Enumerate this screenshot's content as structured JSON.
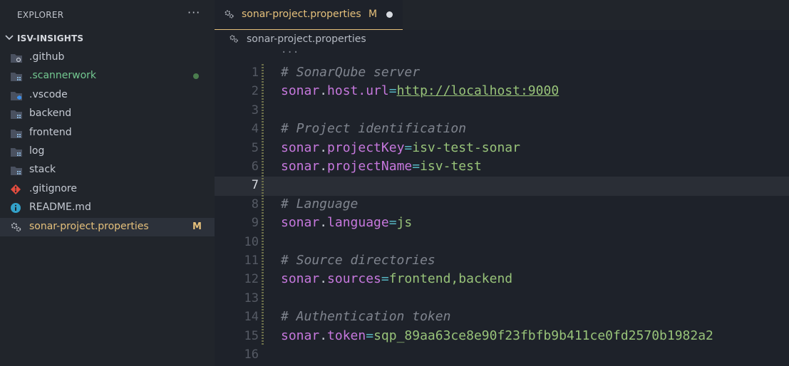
{
  "sidebar": {
    "title": "EXPLORER",
    "more": "···",
    "section": "ISV-INSIGHTS",
    "items": [
      {
        "label": ".github",
        "badge": ""
      },
      {
        "label": ".scannerwork",
        "badge": ""
      },
      {
        "label": ".vscode",
        "badge": ""
      },
      {
        "label": "backend",
        "badge": ""
      },
      {
        "label": "frontend",
        "badge": ""
      },
      {
        "label": "log",
        "badge": ""
      },
      {
        "label": "stack",
        "badge": ""
      },
      {
        "label": ".gitignore",
        "badge": ""
      },
      {
        "label": "README.md",
        "badge": ""
      },
      {
        "label": "sonar-project.properties",
        "badge": "M"
      }
    ]
  },
  "tab": {
    "label": "sonar-project.properties",
    "status": "M"
  },
  "breadcrumb": {
    "label": "sonar-project.properties",
    "sticky": "···"
  },
  "editor": {
    "current_line": 7,
    "lines": [
      {
        "n": "1",
        "comment": "# SonarQube server"
      },
      {
        "n": "2",
        "key": "sonar",
        "prop": "host.url",
        "eq": "=",
        "value": "http://localhost:9000"
      },
      {
        "n": "3"
      },
      {
        "n": "4",
        "comment": "# Project identification"
      },
      {
        "n": "5",
        "key": "sonar",
        "prop": "projectKey",
        "eq": "=",
        "value": "isv-test-sonar"
      },
      {
        "n": "6",
        "key": "sonar",
        "prop": "projectName",
        "eq": "=",
        "value": "isv-test"
      },
      {
        "n": "7"
      },
      {
        "n": "8",
        "comment": "# Language"
      },
      {
        "n": "9",
        "key": "sonar",
        "prop": "language",
        "eq": "=",
        "value": "js"
      },
      {
        "n": "10"
      },
      {
        "n": "11",
        "comment": "# Source directories"
      },
      {
        "n": "12",
        "key": "sonar",
        "prop": "sources",
        "eq": "=",
        "value": "frontend,backend"
      },
      {
        "n": "13"
      },
      {
        "n": "14",
        "comment": "# Authentication token"
      },
      {
        "n": "15",
        "key": "sonar",
        "prop": "token",
        "eq": "=",
        "value": "sqp_89aa63ce8e90f23fbfb9b411ce0fd2570b1982a2"
      },
      {
        "n": "16"
      }
    ]
  },
  "colors": {
    "modified": "#e5c07b",
    "untracked": "#73c991",
    "keyword": "#c678dd",
    "string": "#98c379",
    "comment": "#7f848e"
  }
}
